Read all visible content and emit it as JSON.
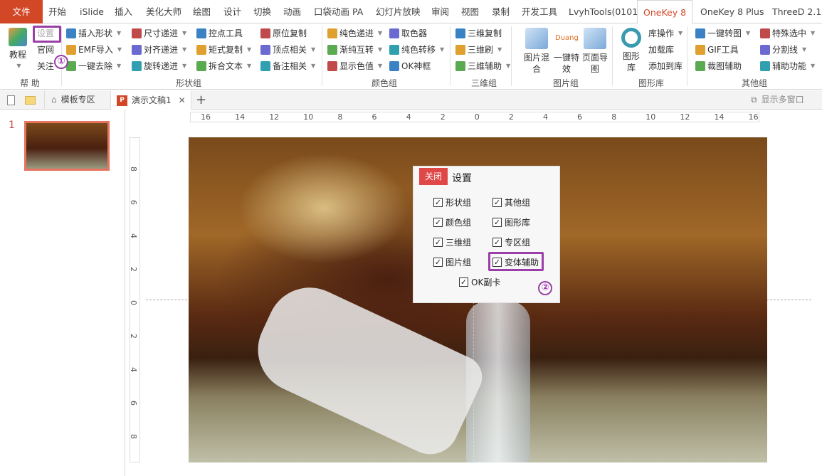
{
  "tabs": [
    "文件",
    "开始",
    "iSlide",
    "插入",
    "美化大师",
    "绘图",
    "设计",
    "切换",
    "动画",
    "口袋动画 PA",
    "幻灯片放映",
    "审阅",
    "视图",
    "录制",
    "开发工具",
    "LvyhTools(0101)",
    "OneKey 8",
    "OneKey 8 Plus",
    "ThreeD 2.1"
  ],
  "active_tab": "OneKey 8",
  "ribbon": {
    "help": {
      "big": "教程",
      "items": [
        "设置",
        "官网",
        "关注"
      ],
      "label": "帮 助"
    },
    "shape": {
      "items": [
        "插入形状",
        "EMF导入",
        "一键去除",
        "尺寸递进",
        "对齐递进",
        "旋转递进",
        "控点工具",
        "矩式复制",
        "拆合文本",
        "原位复制",
        "顶点相关",
        "备注相关"
      ],
      "label": "形状组"
    },
    "color": {
      "items": [
        "纯色递进",
        "渐纯互转",
        "显示色值",
        "取色器",
        "纯色转移",
        "OK神框"
      ],
      "label": "颜色组"
    },
    "three_d": {
      "items": [
        "三维复制",
        "三维刷",
        "三维辅助"
      ],
      "label": "三维组"
    },
    "picture": {
      "big": [
        "图片混合",
        "一键特效",
        "页面导图"
      ],
      "duang": "Duang",
      "label": "图片组"
    },
    "library": {
      "big": "图形库",
      "items": [
        "库操作",
        "加载库",
        "添加到库"
      ],
      "label": "图形库"
    },
    "other": {
      "items": [
        "一键转图",
        "GIF工具",
        "裁图辅助",
        "特殊选中",
        "分割线",
        "辅助功能"
      ],
      "label": "其他组"
    }
  },
  "doctabs": {
    "template": "模板专区",
    "document": "演示文稿1",
    "multi_window": "显示多窗口"
  },
  "slides": {
    "numbers": [
      "1"
    ]
  },
  "ruler": {
    "h": [
      "16",
      "14",
      "12",
      "10",
      "8",
      "6",
      "4",
      "2",
      "0",
      "2",
      "4",
      "6",
      "8",
      "10",
      "12",
      "14",
      "16"
    ],
    "v": [
      "8",
      "6",
      "4",
      "2",
      "0",
      "2",
      "4",
      "6",
      "8"
    ]
  },
  "dialog": {
    "close": "关闭",
    "title": "设置",
    "options": [
      {
        "label": "形状组",
        "checked": true
      },
      {
        "label": "其他组",
        "checked": true
      },
      {
        "label": "颜色组",
        "checked": true
      },
      {
        "label": "图形库",
        "checked": true
      },
      {
        "label": "三维组",
        "checked": true
      },
      {
        "label": "专区组",
        "checked": true
      },
      {
        "label": "图片组",
        "checked": true
      },
      {
        "label": "变体辅助",
        "checked": true
      },
      {
        "label": "OK副卡",
        "checked": true
      }
    ]
  },
  "annotations": [
    "①",
    "②"
  ],
  "colors": {
    "accent": "#d24726",
    "highlight": "#9b3fa8",
    "close": "#e04848"
  }
}
